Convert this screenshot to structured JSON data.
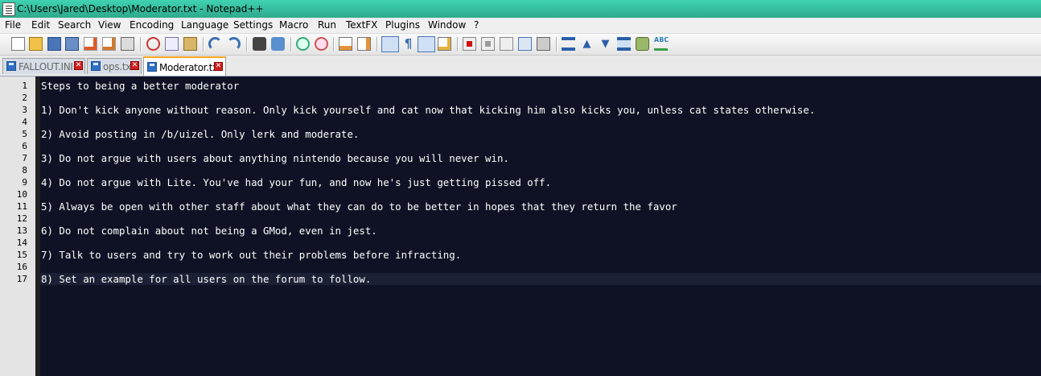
{
  "window": {
    "title": "C:\\Users\\Jared\\Desktop\\Moderator.txt - Notepad++"
  },
  "menu": [
    "File",
    "Edit",
    "Search",
    "View",
    "Encoding",
    "Language",
    "Settings",
    "Macro",
    "Run",
    "TextFX",
    "Plugins",
    "Window",
    "?"
  ],
  "toolbar_icons": [
    "new-file-icon",
    "open-file-icon",
    "save-icon",
    "save-all-icon",
    "close-icon",
    "close-all-icon",
    "print-icon",
    "cut-icon",
    "copy-icon",
    "paste-icon",
    "undo-icon",
    "redo-icon",
    "find-icon",
    "replace-icon",
    "zoom-in-icon",
    "zoom-out-icon",
    "sync-vertical-icon",
    "sync-horizontal-icon",
    "word-wrap-icon",
    "show-all-chars-icon",
    "indent-guide-icon",
    "user-lang-icon",
    "record-macro-icon",
    "stop-record-icon",
    "play-macro-icon",
    "run-macro-multiple-icon",
    "save-macro-icon",
    "fold-all-icon",
    "previous-icon",
    "next-icon",
    "unfold-all-icon",
    "clipboard-history-icon",
    "spell-check-icon"
  ],
  "tabs": [
    {
      "label": "FALLOUT.INI",
      "active": false
    },
    {
      "label": "ops.txt",
      "active": false
    },
    {
      "label": "Moderator.txt",
      "active": true
    }
  ],
  "editor": {
    "line_numbers": [
      "1",
      "2",
      "3",
      "4",
      "5",
      "6",
      "7",
      "8",
      "9",
      "10",
      "11",
      "12",
      "13",
      "14",
      "15",
      "16",
      "17"
    ],
    "lines": [
      "Steps to being a better moderator",
      "",
      "1) Don't kick anyone without reason. Only kick yourself and cat now that kicking him also kicks you, unless cat states otherwise.",
      "",
      "2) Avoid posting in /b/uizel. Only lerk and moderate.",
      "",
      "3) Do not argue with users about anything nintendo because you will never win.",
      "",
      "4) Do not argue with Lite. You've had your fun, and now he's just getting pissed off.",
      "",
      "5) Always be open with other staff about what they can do to be better in hopes that they return the favor",
      "",
      "6) Do not complain about not being a GMod, even in jest.",
      "",
      "7) Talk to users and try to work out their problems before infracting.",
      "",
      "8) Set an example for all users on the forum to follow."
    ],
    "current_line": 17
  },
  "colors": {
    "editor_bg": "#0f1224",
    "text": "#ffffff",
    "title_bg": "#3fd2b1",
    "active_tab_accent": "#f5a623"
  }
}
